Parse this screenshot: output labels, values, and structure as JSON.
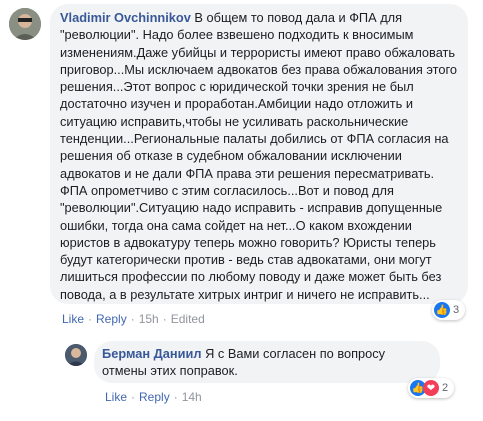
{
  "comment": {
    "author": "Vladimir Ovchinnikov",
    "text": "В общем то повод дала и ФПА для \"революции\". Надо более взвешено подходить к вносимым изменениям.Даже убийцы и террористы имеют право обжаловать приговор...Мы исключаем адвокатов без права обжалования этого решения...Этот вопрос с юридической точки зрения не был достаточно изучен и проработан.Амбиции надо отложить и ситуацию исправить,чтобы не усиливать раскольнические тенденции...Региональные палаты добились от ФПА согласия на решения об отказе в судебном обжаловании исключении адвокатов и не дали ФПА права эти решения пересматривать. ФПА опрометчиво с этим согласилось...Вот и повод для \"революции\".Ситуацию надо исправить - исправив допущенные ошибки, тогда она сама сойдет на нет...О каком вхождении юристов в адвокатуру теперь можно говорить? Юристы теперь будут категорически против - ведь став адвокатами, они могут лишиться профессии по любому поводу и даже может быть без повода, а в результате хитрых интриг и ничего не исправить...",
    "actions": {
      "like": "Like",
      "reply": "Reply",
      "time": "15h",
      "edited": "Edited"
    },
    "reactions": {
      "count": "3",
      "icons": [
        "like-icon"
      ]
    }
  },
  "reply": {
    "author": "Берман Даниил",
    "text": "Я с Вами согласен по вопросу отмены этих поправок.",
    "actions": {
      "like": "Like",
      "reply": "Reply",
      "time": "14h"
    },
    "reactions": {
      "count": "2",
      "icons": [
        "like-icon",
        "love-icon"
      ]
    }
  },
  "colors": {
    "link": "#385898",
    "bubble": "#f2f3f5",
    "action": "#4267b2"
  }
}
